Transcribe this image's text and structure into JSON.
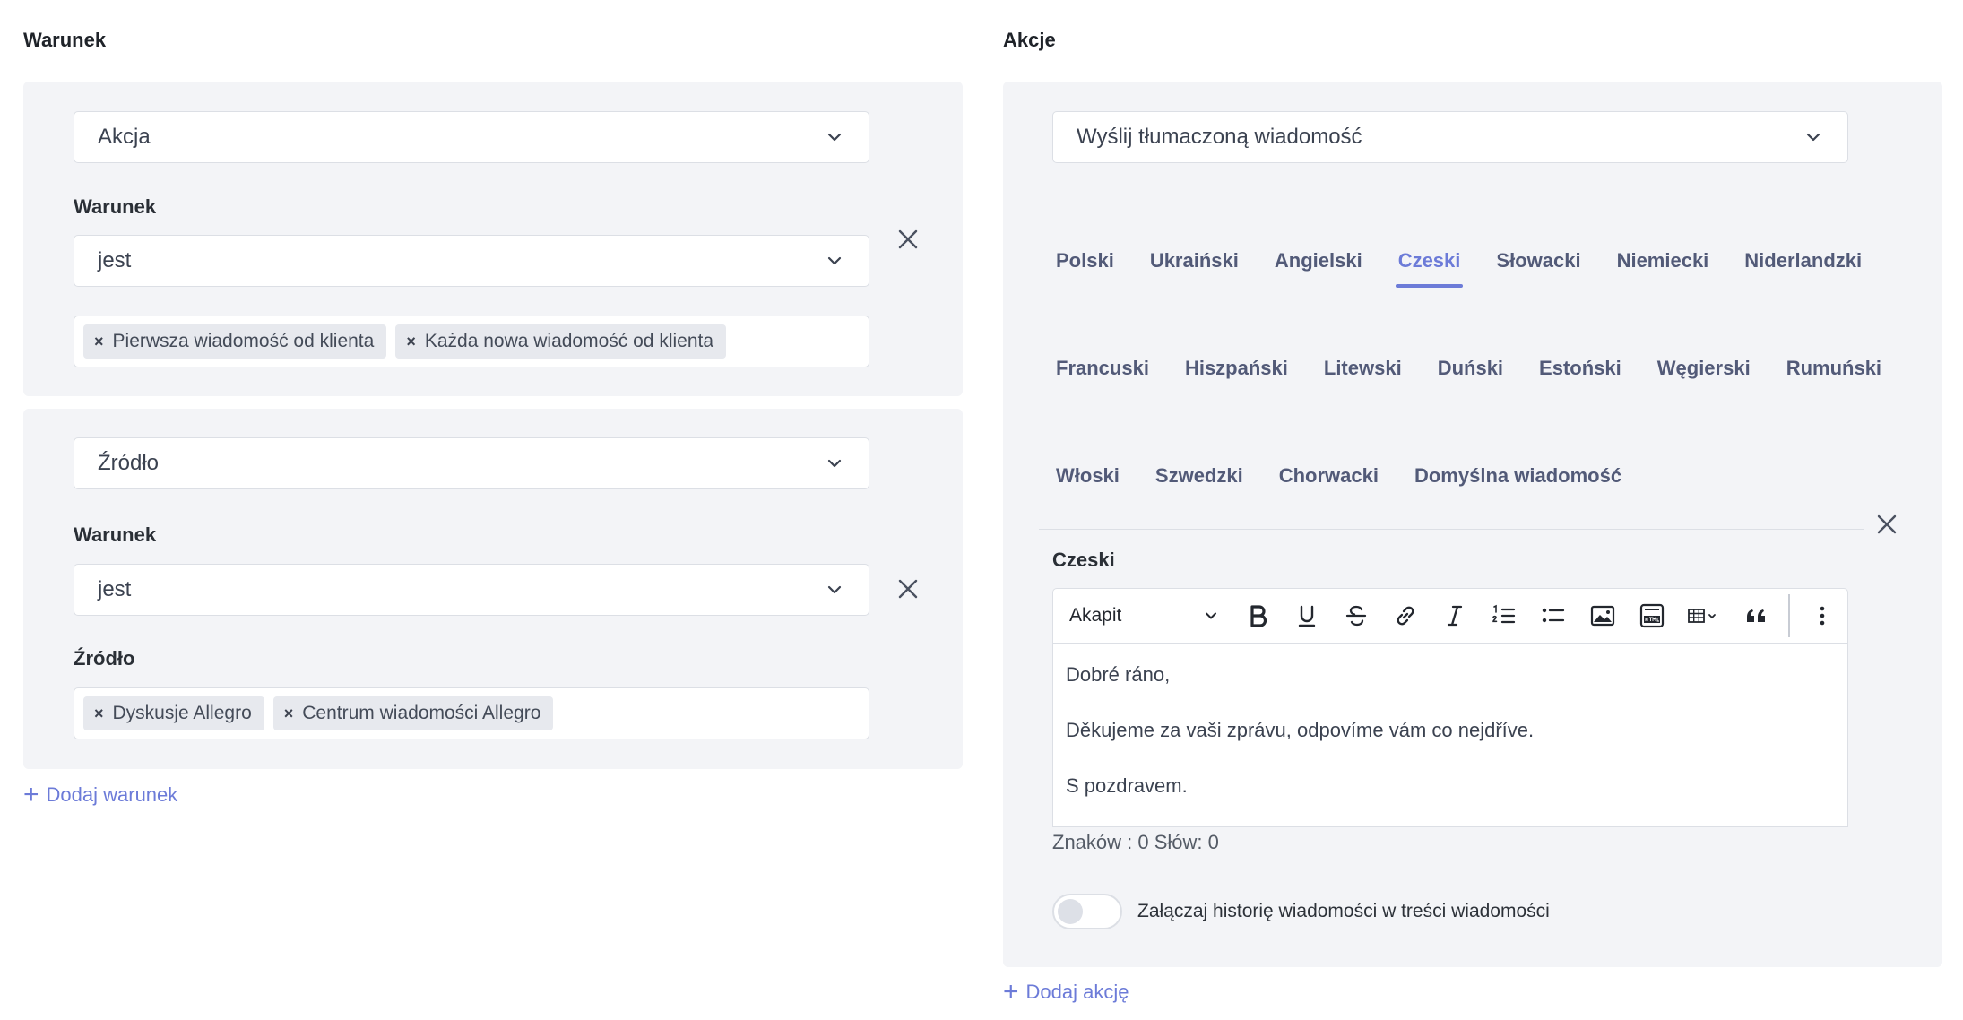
{
  "left": {
    "title": "Warunek",
    "blocks": [
      {
        "type_select": "Akcja",
        "condition_label": "Warunek",
        "condition_select": "jest",
        "tags": [
          "Pierwsza wiadomość od klienta",
          "Każda nowa wiadomość od klienta"
        ]
      },
      {
        "type_select": "Źródło",
        "condition_label": "Warunek",
        "condition_select": "jest",
        "source_label": "Źródło",
        "tags": [
          "Dyskusje Allegro",
          "Centrum wiadomości Allegro"
        ]
      }
    ],
    "add_condition": "Dodaj warunek"
  },
  "right": {
    "title": "Akcje",
    "action_select": "Wyślij tłumaczoną wiadomość",
    "languages_row1": [
      "Polski",
      "Ukraiński",
      "Angielski",
      "Czeski",
      "Słowacki",
      "Niemiecki",
      "Niderlandzki"
    ],
    "languages_row2": [
      "Francuski",
      "Hiszpański",
      "Litewski",
      "Duński",
      "Estoński",
      "Węgierski",
      "Rumuński"
    ],
    "languages_row3": [
      "Włoski",
      "Szwedzki",
      "Chorwacki",
      "Domyślna wiadomość"
    ],
    "active_language": "Czeski",
    "editor_label": "Czeski",
    "paragraph_style": "Akapit",
    "message": [
      "Dobré ráno,",
      "Děkujeme za vaši zprávu, odpovíme vám co nejdříve.",
      "S pozdravem."
    ],
    "counter": "Znaków : 0 Słów: 0",
    "toggle_label": "Załączaj historię wiadomości w treści wiadomości",
    "toggle_on": false,
    "add_action": "Dodaj akcję"
  },
  "colors": {
    "accent": "#6c7bd8",
    "panel": "#f3f4f7",
    "border": "#dcdfe5"
  }
}
